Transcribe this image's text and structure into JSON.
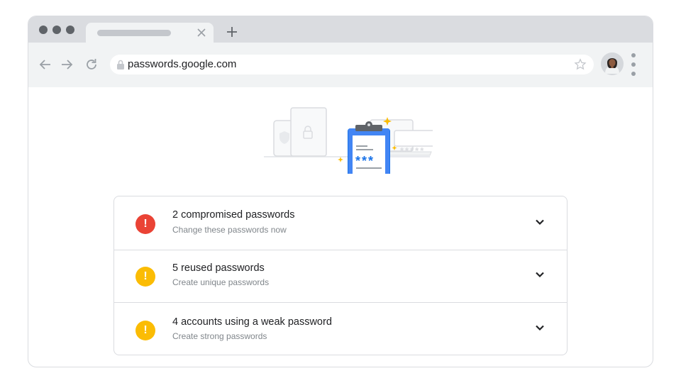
{
  "browser": {
    "url": "passwords.google.com",
    "accent_colors": {
      "error": "#ea4335",
      "warning": "#fbbc04",
      "brand_blue": "#4285f4"
    }
  },
  "checkup": {
    "items": [
      {
        "title": "2 compromised passwords",
        "subtitle": "Change these passwords now",
        "severity": "error",
        "icon": "!"
      },
      {
        "title": "5 reused passwords",
        "subtitle": "Create unique passwords",
        "severity": "warning",
        "icon": "!"
      },
      {
        "title": "4 accounts using a weak password",
        "subtitle": "Create strong passwords",
        "severity": "warning",
        "icon": "!"
      }
    ]
  },
  "illustration": {
    "masked_text": "***",
    "masked_text_small": "*****"
  }
}
